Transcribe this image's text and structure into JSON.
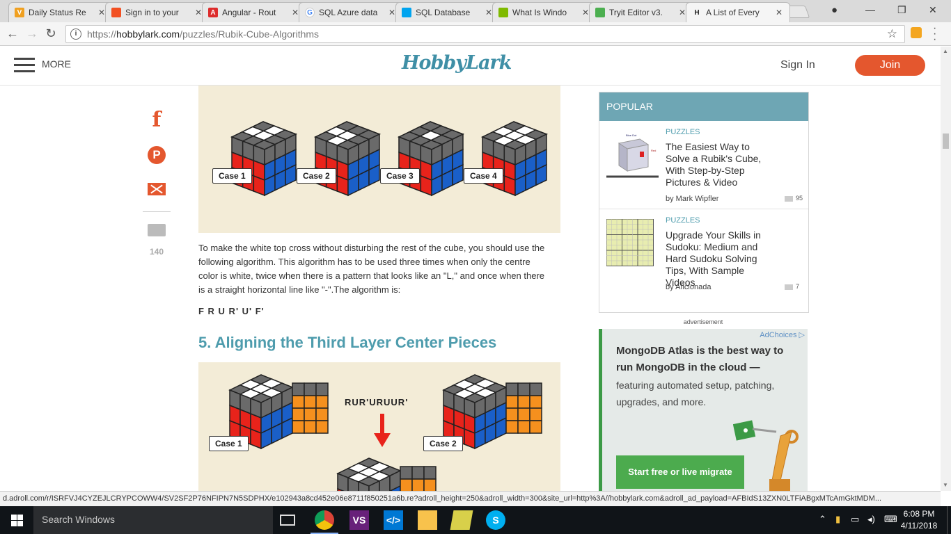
{
  "browser": {
    "tabs": [
      {
        "label": "Daily Status Re",
        "favicon": "V",
        "color": "#f0a020"
      },
      {
        "label": "Sign in to your",
        "favicon": "ms",
        "color": "#f25022"
      },
      {
        "label": "Angular - Rout",
        "favicon": "A",
        "color": "#dd2c2c"
      },
      {
        "label": "SQL Azure data",
        "favicon": "G",
        "color": "#4285f4"
      },
      {
        "label": "SQL Database",
        "favicon": "ms",
        "color": "#00a4ef"
      },
      {
        "label": "What Is Windo",
        "favicon": "ms",
        "color": "#7fba00"
      },
      {
        "label": "Tryit Editor v3.",
        "favicon": "w3",
        "color": "#4caf50"
      },
      {
        "label": "A List of Every",
        "favicon": "H",
        "color": "#333333"
      }
    ],
    "url_proto": "https://",
    "url_host": "hobbylark.com",
    "url_path": "/puzzles/Rubik-Cube-Algorithms"
  },
  "site": {
    "menu_label": "MORE",
    "logo": "HobbyLark",
    "sign_in": "Sign In",
    "join": "Join"
  },
  "share": {
    "fb": "f",
    "pin": "P",
    "comment_count": "140"
  },
  "article": {
    "fig1_cases": [
      "Case 1",
      "Case 2",
      "Case 3",
      "Case 4"
    ],
    "paragraph": "To make the white top cross without disturbing the rest of the cube, you should use the following algorithm. This algorithm has to be used three times when only the centre color is white, twice when there is a pattern that looks like an \"L,\" and once when there is a straight horizontal line like \"-\".The algorithm is:",
    "algorithm": "F R U R' U' F'",
    "section_heading": "5. Aligning the Third Layer Center Pieces",
    "fig2_algorithm": "RUR'URUUR'",
    "fig2_cases": [
      "Case 1",
      "Case 2"
    ]
  },
  "sidebar": {
    "popular_title": "POPULAR",
    "items": [
      {
        "category": "PUZZLES",
        "title": "The Easiest Way to Solve a Rubik's Cube, With Step-by-Step Pictures & Video",
        "author": "by Mark Wipfler",
        "comments": "95"
      },
      {
        "category": "PUZZLES",
        "title": "Upgrade Your Skills in Sudoku: Medium and Hard Sudoku Solving Tips, With Sample Videos",
        "author": "by Aficionada",
        "comments": "7"
      }
    ],
    "ad_label": "advertisement",
    "adchoices": "AdChoices",
    "ad_headline": "MongoDB Atlas is the best way to run MongoDB in the cloud —",
    "ad_body": "featuring automated setup, patching, upgrades, and more.",
    "ad_cta": "Start free or live migrate"
  },
  "status_url": "d.adroll.com/r/ISRFVJ4CYZEJLCRYPCOWW4/SV2SF2P76NFIPN7N5SDPHX/e102943a8cd452e06e8711f850251a6b.re?adroll_height=250&adroll_width=300&site_url=http%3A//hobbylark.com&adroll_ad_payload=AFBIdS13ZXN0LTFiABgxMTcAmGktMDM...",
  "taskbar": {
    "search_placeholder": "Search Windows",
    "time": "6:08 PM",
    "date": "4/11/2018"
  }
}
